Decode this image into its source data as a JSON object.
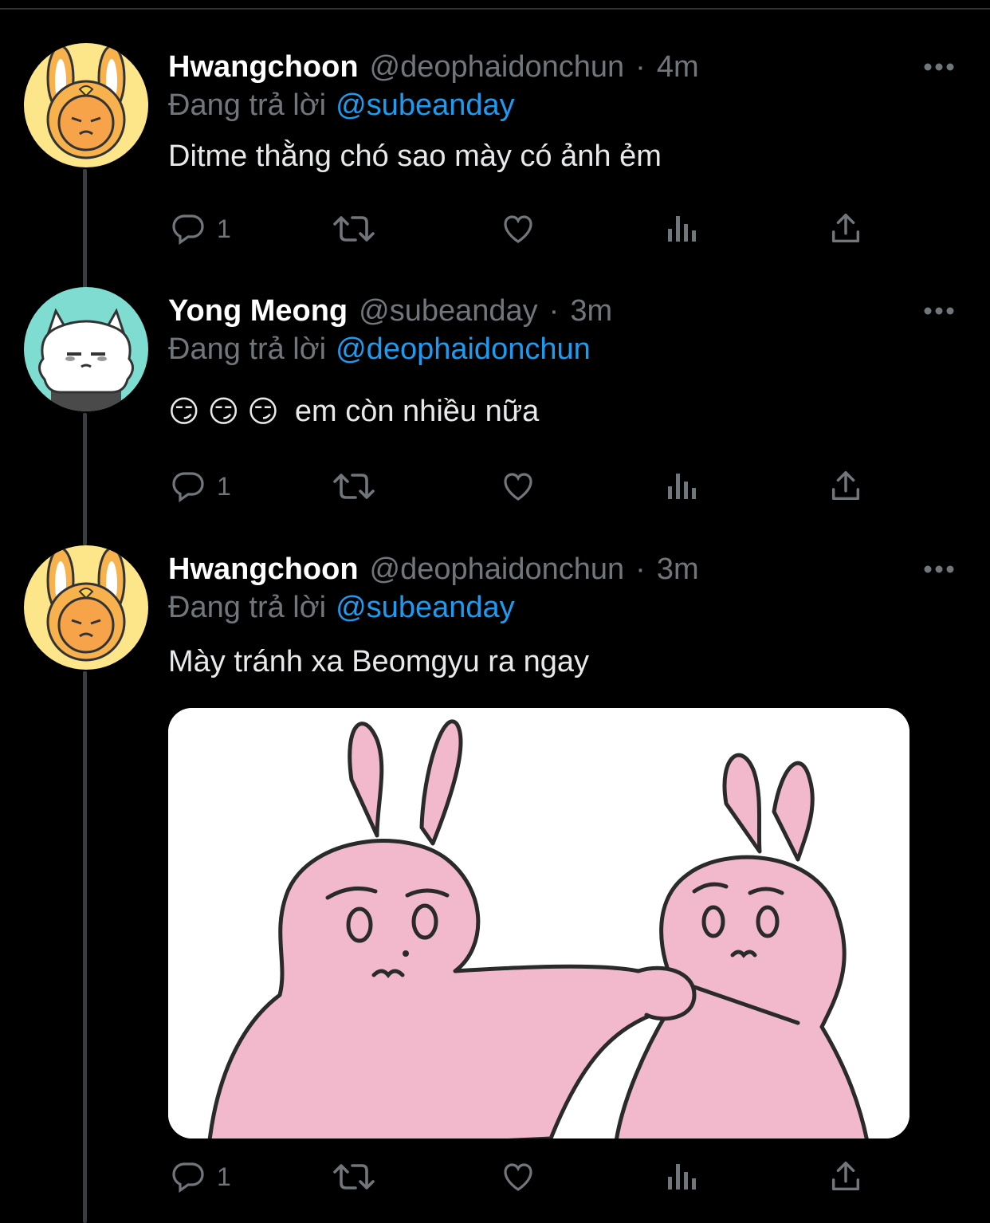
{
  "tweets": [
    {
      "name": "Hwangchoon",
      "handle": "@deophaidonchun",
      "time": "4m",
      "replying_prefix": "Đang trả lời",
      "replying_to": "@subeanday",
      "text": "Ditme thằng chó sao mày có ảnh ẻm",
      "reply_count": "1",
      "avatar": "yellow-bunny-avatar"
    },
    {
      "name": "Yong Meong",
      "handle": "@subeanday",
      "time": "3m",
      "replying_prefix": "Đang trả lời",
      "replying_to": "@deophaidonchun",
      "text": "em còn nhiều nữa",
      "emojis": [
        "😏",
        "😏",
        "😏"
      ],
      "reply_count": "1",
      "avatar": "white-dog-avatar"
    },
    {
      "name": "Hwangchoon",
      "handle": "@deophaidonchun",
      "time": "3m",
      "replying_prefix": "Đang trả lời",
      "replying_to": "@subeanday",
      "text": "Mày tránh xa Beomgyu ra ngay",
      "reply_count": "1",
      "avatar": "yellow-bunny-avatar",
      "media": "pink-bunnies-meme-image"
    }
  ],
  "separator": "·",
  "colors": {
    "background": "#000000",
    "text": "#e7e9ea",
    "secondary": "#71767b",
    "accent": "#1d9bf0",
    "thread_line": "#3a3d40",
    "avatar_yellow": "#fde68a",
    "avatar_teal": "#7fdcd0",
    "bunny_pink": "#f2b8cc"
  },
  "icons": [
    "more-icon",
    "reply-icon",
    "retweet-icon",
    "like-icon",
    "analytics-icon",
    "share-icon"
  ]
}
